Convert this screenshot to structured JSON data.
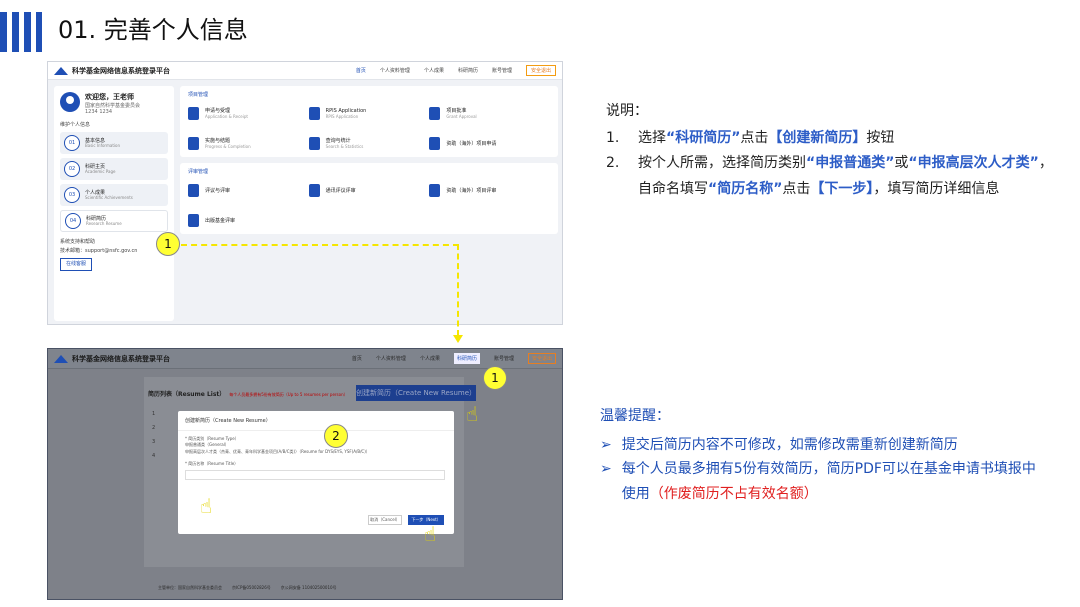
{
  "slide": {
    "title": "01. 完善个人信息"
  },
  "shot1": {
    "app_title": "科学基金网络信息系统登录平台",
    "nav": [
      "首页",
      "个人资料管理",
      "个人成果",
      "科研简历",
      "账号管理"
    ],
    "exit": "安全退出",
    "user": {
      "greeting": "欢迎您，王老师",
      "org": "国家自然科学基金委员会",
      "phone": "1234 1234"
    },
    "sidebar_section": "维护个人信息",
    "sidebar_items": [
      {
        "num": "01",
        "label": "基本信息",
        "en": "Basic Information"
      },
      {
        "num": "02",
        "label": "科研主页",
        "en": "Academic Page"
      },
      {
        "num": "03",
        "label": "个人成果",
        "en": "Scientific Achievements"
      },
      {
        "num": "04",
        "label": "科研简历",
        "en": "Research Resume"
      }
    ],
    "support": {
      "title": "系统支持和帮助",
      "email": "技术邮箱：support@nsfc.gov.cn",
      "online": "在线客服"
    },
    "panel1": {
      "title": "项目管理",
      "cards": [
        {
          "label": "申请与受理",
          "en": "Application & Receipt"
        },
        {
          "label": "RPIS Application",
          "en": "RPIS Application"
        },
        {
          "label": "项目批准",
          "en": "Grant Approval"
        },
        {
          "label": "实施与结题",
          "en": "Progress & Completion"
        },
        {
          "label": "查询与统计",
          "en": "Search & Statistics"
        },
        {
          "label": "资助（海外）项目申请",
          "en": ""
        }
      ]
    },
    "panel2": {
      "title": "评审管理",
      "cards": [
        {
          "label": "评议与评审",
          "en": ""
        },
        {
          "label": "通讯评议评审",
          "en": ""
        },
        {
          "label": "资助（海外）项目评审",
          "en": ""
        },
        {
          "label": "出版基金评审",
          "en": ""
        }
      ]
    }
  },
  "shot2": {
    "app_title": "科学基金网络信息系统登录平台",
    "nav": [
      "首页",
      "个人资料管理",
      "个人成果",
      "科研简历",
      "账号管理"
    ],
    "exit": "安全退出",
    "list_title": "简历列表（Resume List）",
    "list_note": "每个人员最多拥有5份有效简历（Up to 5 resumes per person）",
    "new_button": "创建新简历（Create New Resume）",
    "row_nums": [
      "1",
      "2",
      "3",
      "4"
    ],
    "modal": {
      "title": "创建新简历（Create New Resume）",
      "type_label": "* 简历类别（Resume Type）",
      "type_option1": "申报普通类（General）",
      "type_option2": "申报高层次人才类（杰青、优青、青年科学基金项目(A/B/C类)）（Resume for DYS/EYS, YSF(A/B/C)）",
      "name_label": "* 简历名称（Resume Title）",
      "cancel": "取消（Cancel）",
      "next": "下一步（Next）"
    },
    "footer": [
      "主管单位：国家自然科学基金委员会",
      "京ICP备05002826号",
      "京公网安备 110402500010号"
    ]
  },
  "callouts": {
    "c1": "1",
    "c2": "1",
    "c3": "2"
  },
  "notes": {
    "heading": "说明：",
    "item1": {
      "n": "1.",
      "a": "选择",
      "b": "“科研简历”",
      "c": "点击",
      "d": "【创建新简历】",
      "e": "按钮"
    },
    "item2": {
      "n": "2.",
      "a": "按个人所需，选择简历类别",
      "b": "“申报普通类”",
      "c": "或",
      "d": "“申报高层次人才类”",
      "e": "，自命名填写",
      "f": "“简历名称”",
      "g": "点击",
      "h": "【下一步】",
      "i": "，填写简历详细信息"
    }
  },
  "tips": {
    "heading": "温馨提醒：",
    "marker": "➢",
    "tip1": "提交后简历内容不可修改，如需修改需重新创建新简历",
    "tip2a": "每个人员最多拥有5份有效简历，简历PDF可以在基金申请书填报中使用",
    "tip2b": "（作废简历不占有效名额）"
  }
}
